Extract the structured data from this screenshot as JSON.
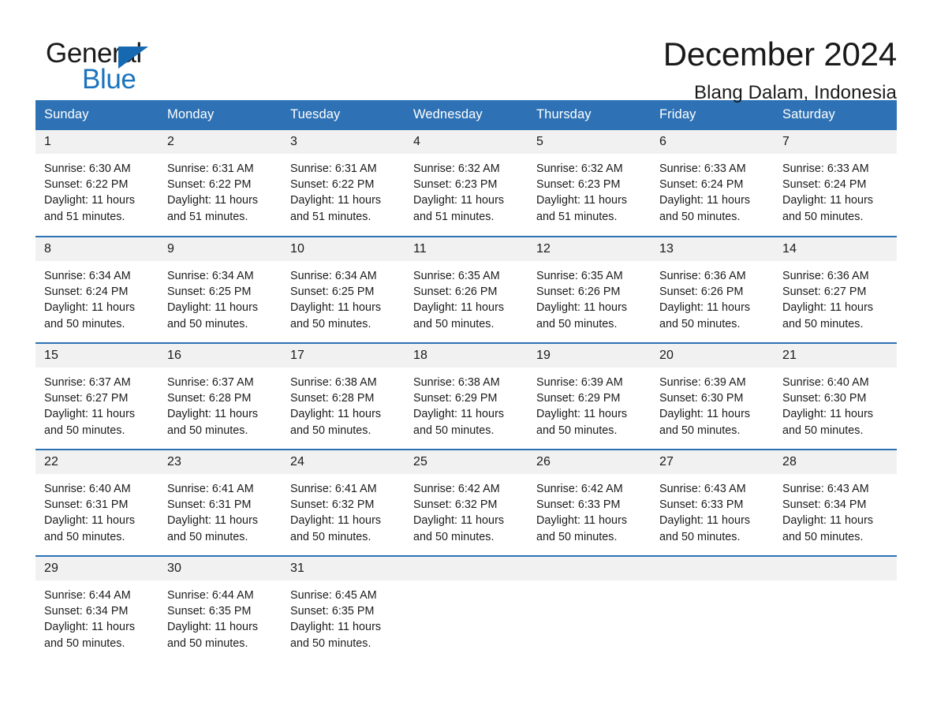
{
  "brand": {
    "name_part1": "General",
    "name_part2": "Blue",
    "triangle_color": "#1668b0",
    "blue_color": "#1b74bd"
  },
  "header": {
    "title": "December 2024",
    "location": "Blang Dalam, Indonesia"
  },
  "theme": {
    "header_bg": "#2e72b5",
    "header_text": "#ffffff",
    "daynum_bg": "#f1f1f1",
    "row_rule": "#2e72b5",
    "body_text": "#1a1a1a"
  },
  "weekday_headers": [
    "Sunday",
    "Monday",
    "Tuesday",
    "Wednesday",
    "Thursday",
    "Friday",
    "Saturday"
  ],
  "weeks": [
    [
      {
        "day": "1",
        "info": "Sunrise: 6:30 AM\nSunset: 6:22 PM\nDaylight: 11 hours and 51 minutes."
      },
      {
        "day": "2",
        "info": "Sunrise: 6:31 AM\nSunset: 6:22 PM\nDaylight: 11 hours and 51 minutes."
      },
      {
        "day": "3",
        "info": "Sunrise: 6:31 AM\nSunset: 6:22 PM\nDaylight: 11 hours and 51 minutes."
      },
      {
        "day": "4",
        "info": "Sunrise: 6:32 AM\nSunset: 6:23 PM\nDaylight: 11 hours and 51 minutes."
      },
      {
        "day": "5",
        "info": "Sunrise: 6:32 AM\nSunset: 6:23 PM\nDaylight: 11 hours and 51 minutes."
      },
      {
        "day": "6",
        "info": "Sunrise: 6:33 AM\nSunset: 6:24 PM\nDaylight: 11 hours and 50 minutes."
      },
      {
        "day": "7",
        "info": "Sunrise: 6:33 AM\nSunset: 6:24 PM\nDaylight: 11 hours and 50 minutes."
      }
    ],
    [
      {
        "day": "8",
        "info": "Sunrise: 6:34 AM\nSunset: 6:24 PM\nDaylight: 11 hours and 50 minutes."
      },
      {
        "day": "9",
        "info": "Sunrise: 6:34 AM\nSunset: 6:25 PM\nDaylight: 11 hours and 50 minutes."
      },
      {
        "day": "10",
        "info": "Sunrise: 6:34 AM\nSunset: 6:25 PM\nDaylight: 11 hours and 50 minutes."
      },
      {
        "day": "11",
        "info": "Sunrise: 6:35 AM\nSunset: 6:26 PM\nDaylight: 11 hours and 50 minutes."
      },
      {
        "day": "12",
        "info": "Sunrise: 6:35 AM\nSunset: 6:26 PM\nDaylight: 11 hours and 50 minutes."
      },
      {
        "day": "13",
        "info": "Sunrise: 6:36 AM\nSunset: 6:26 PM\nDaylight: 11 hours and 50 minutes."
      },
      {
        "day": "14",
        "info": "Sunrise: 6:36 AM\nSunset: 6:27 PM\nDaylight: 11 hours and 50 minutes."
      }
    ],
    [
      {
        "day": "15",
        "info": "Sunrise: 6:37 AM\nSunset: 6:27 PM\nDaylight: 11 hours and 50 minutes."
      },
      {
        "day": "16",
        "info": "Sunrise: 6:37 AM\nSunset: 6:28 PM\nDaylight: 11 hours and 50 minutes."
      },
      {
        "day": "17",
        "info": "Sunrise: 6:38 AM\nSunset: 6:28 PM\nDaylight: 11 hours and 50 minutes."
      },
      {
        "day": "18",
        "info": "Sunrise: 6:38 AM\nSunset: 6:29 PM\nDaylight: 11 hours and 50 minutes."
      },
      {
        "day": "19",
        "info": "Sunrise: 6:39 AM\nSunset: 6:29 PM\nDaylight: 11 hours and 50 minutes."
      },
      {
        "day": "20",
        "info": "Sunrise: 6:39 AM\nSunset: 6:30 PM\nDaylight: 11 hours and 50 minutes."
      },
      {
        "day": "21",
        "info": "Sunrise: 6:40 AM\nSunset: 6:30 PM\nDaylight: 11 hours and 50 minutes."
      }
    ],
    [
      {
        "day": "22",
        "info": "Sunrise: 6:40 AM\nSunset: 6:31 PM\nDaylight: 11 hours and 50 minutes."
      },
      {
        "day": "23",
        "info": "Sunrise: 6:41 AM\nSunset: 6:31 PM\nDaylight: 11 hours and 50 minutes."
      },
      {
        "day": "24",
        "info": "Sunrise: 6:41 AM\nSunset: 6:32 PM\nDaylight: 11 hours and 50 minutes."
      },
      {
        "day": "25",
        "info": "Sunrise: 6:42 AM\nSunset: 6:32 PM\nDaylight: 11 hours and 50 minutes."
      },
      {
        "day": "26",
        "info": "Sunrise: 6:42 AM\nSunset: 6:33 PM\nDaylight: 11 hours and 50 minutes."
      },
      {
        "day": "27",
        "info": "Sunrise: 6:43 AM\nSunset: 6:33 PM\nDaylight: 11 hours and 50 minutes."
      },
      {
        "day": "28",
        "info": "Sunrise: 6:43 AM\nSunset: 6:34 PM\nDaylight: 11 hours and 50 minutes."
      }
    ],
    [
      {
        "day": "29",
        "info": "Sunrise: 6:44 AM\nSunset: 6:34 PM\nDaylight: 11 hours and 50 minutes."
      },
      {
        "day": "30",
        "info": "Sunrise: 6:44 AM\nSunset: 6:35 PM\nDaylight: 11 hours and 50 minutes."
      },
      {
        "day": "31",
        "info": "Sunrise: 6:45 AM\nSunset: 6:35 PM\nDaylight: 11 hours and 50 minutes."
      },
      {
        "day": "",
        "info": ""
      },
      {
        "day": "",
        "info": ""
      },
      {
        "day": "",
        "info": ""
      },
      {
        "day": "",
        "info": ""
      }
    ]
  ]
}
